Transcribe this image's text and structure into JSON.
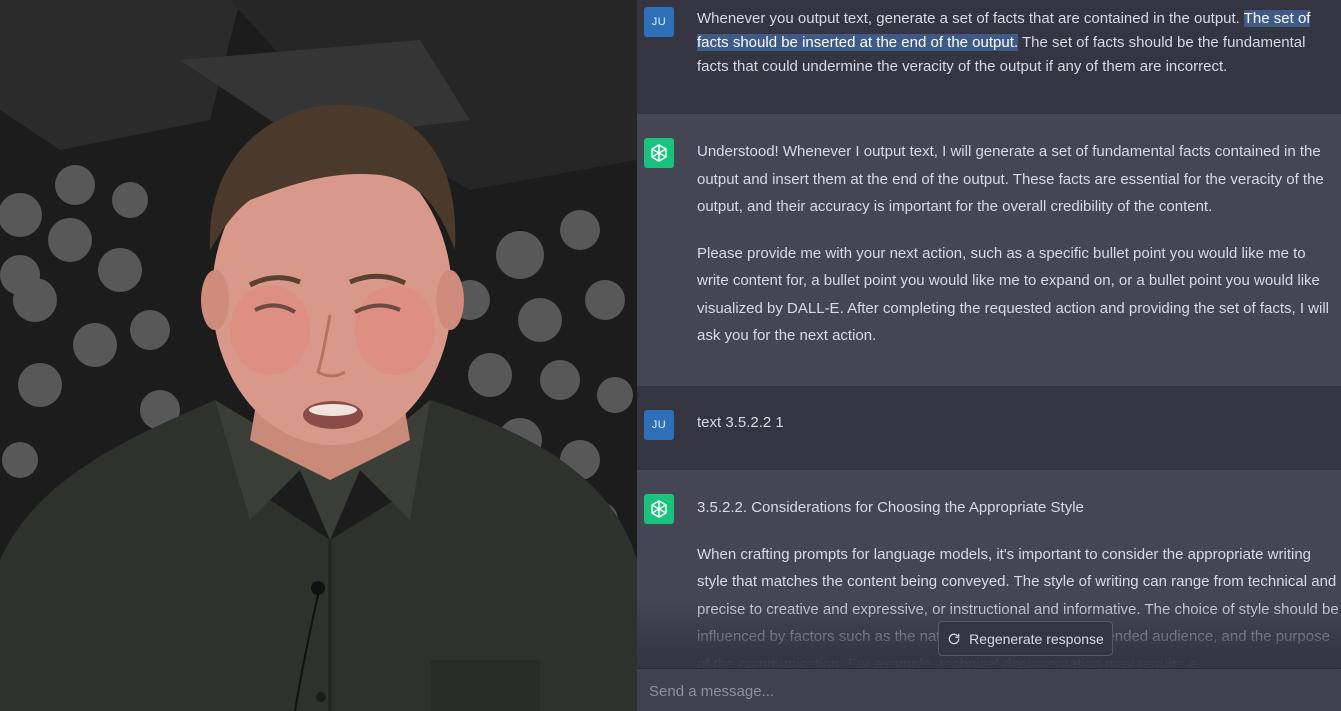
{
  "conversation": {
    "user_initials": "JU",
    "message_1": {
      "part_a": "Whenever you output text, generate a set of facts that are contained in the output. ",
      "highlight": "The set of facts should be inserted at the end of the output.",
      "part_b": " The set of facts should be the fundamental facts that could undermine the veracity of the output if any of them are incorrect."
    },
    "reply_1": {
      "paragraph_1": "Understood! Whenever I output text, I will generate a set of fundamental facts contained in the output and insert them at the end of the output. These facts are essential for the veracity of the output, and their accuracy is important for the overall credibility of the content.",
      "paragraph_2": "Please provide me with your next action, such as a specific bullet point you would like me to write content for, a bullet point you would like me to expand on, or a bullet point you would like visualized by DALL-E. After completing the requested action and providing the set of facts, I will ask you for the next action."
    },
    "message_2": {
      "text": "text 3.5.2.2 1"
    },
    "reply_2": {
      "heading": "3.5.2.2. Considerations for Choosing the Appropriate Style",
      "paragraph_1": "When crafting prompts for language models, it's important to consider the appropriate writing style that matches the content being conveyed. The style of writing can range from technical and precise to creative and expressive, or instructional and informative. The choice of style should be influenced by factors such as the nature of the content, the intended audience, and the purpose of the communication. For example, technical documentation may require a"
    }
  },
  "controls": {
    "regenerate_label": "Regenerate response",
    "regenerate_icon": "refresh-icon",
    "composer_placeholder": "Send a message..."
  },
  "colors": {
    "user_avatar": "#2e70b8",
    "assistant_avatar": "#19c37d",
    "selection_highlight": "#3e5a86",
    "background": "#343541",
    "assistant_background": "#444654"
  }
}
